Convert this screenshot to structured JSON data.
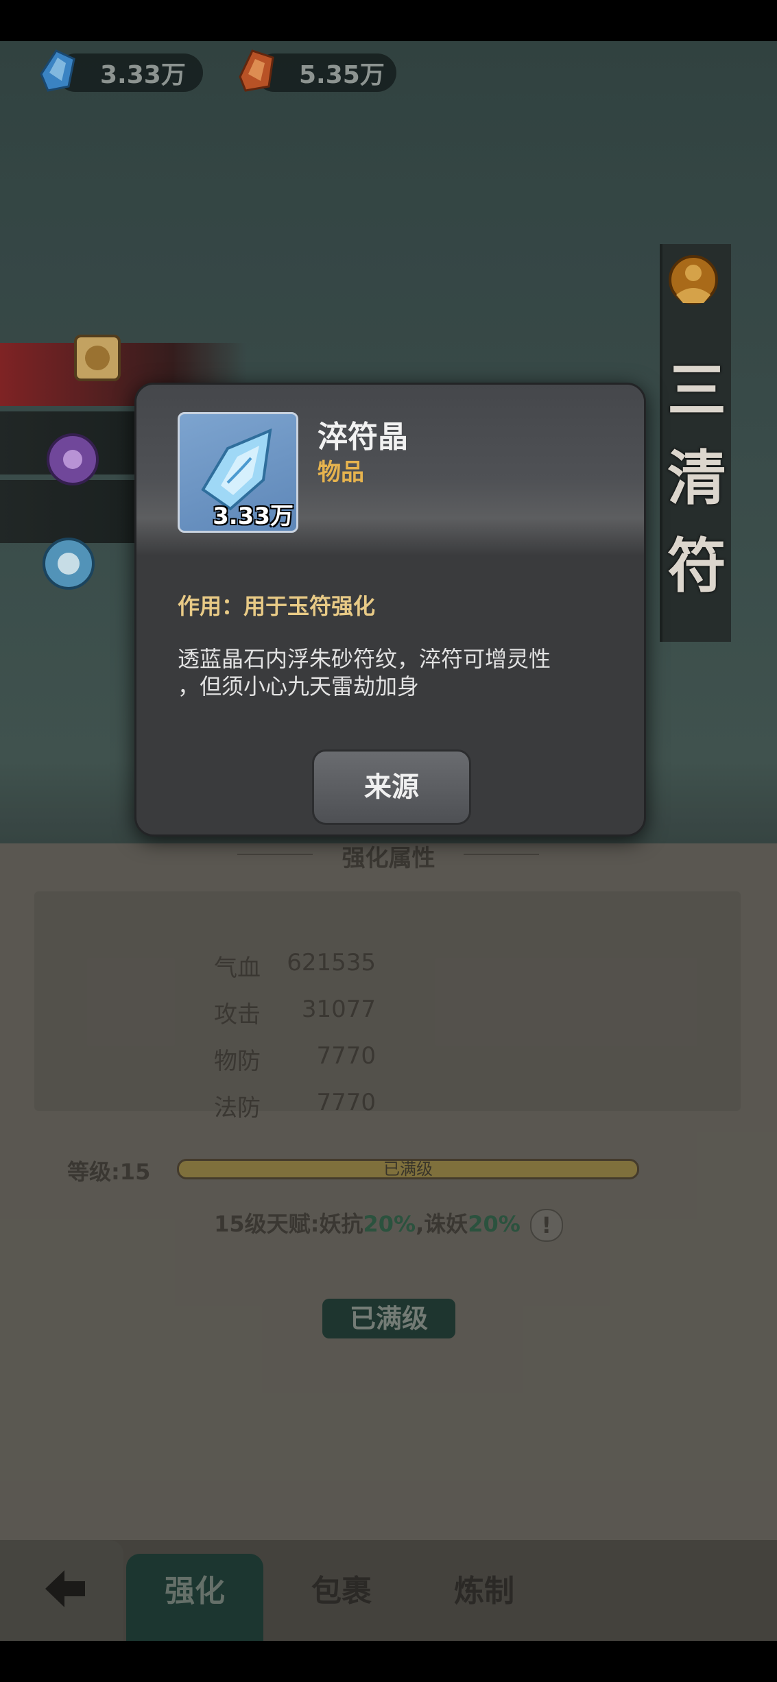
{
  "resources": {
    "blue_crystal": "3.33万",
    "orange_crystal": "5.35万"
  },
  "banner": {
    "chars": [
      "三",
      "清",
      "符"
    ]
  },
  "enhance": {
    "section_title": "强化属性",
    "stats": [
      {
        "label": "气血",
        "value": "621535"
      },
      {
        "label": "攻击",
        "value": "31077"
      },
      {
        "label": "物防",
        "value": "7770"
      },
      {
        "label": "法防",
        "value": "7770"
      }
    ],
    "level_label": "等级:15",
    "level_bar_text": "已满级",
    "level_progress": 1.0,
    "talent_prefix": "15级天赋:妖抗",
    "talent_val1": "20%",
    "talent_mid": ",诛妖",
    "talent_val2": "20%",
    "max_button": "已满级"
  },
  "tabs": {
    "back": "back-arrow-icon",
    "items": [
      "强化",
      "包裹",
      "炼制"
    ],
    "active": 0
  },
  "modal": {
    "item_name": "淬符晶",
    "item_type": "物品",
    "item_count": "3.33万",
    "usage": "作用：用于玉符强化",
    "description_line1": "透蓝晶石内浮朱砂符纹，淬符可增灵性",
    "description_line2": "，但须小心九天雷劫加身",
    "source_button": "来源"
  },
  "colors": {
    "accent_gold": "#e6b34e",
    "usage_text": "#e8ca86",
    "active_tab": "#1f3b35"
  }
}
